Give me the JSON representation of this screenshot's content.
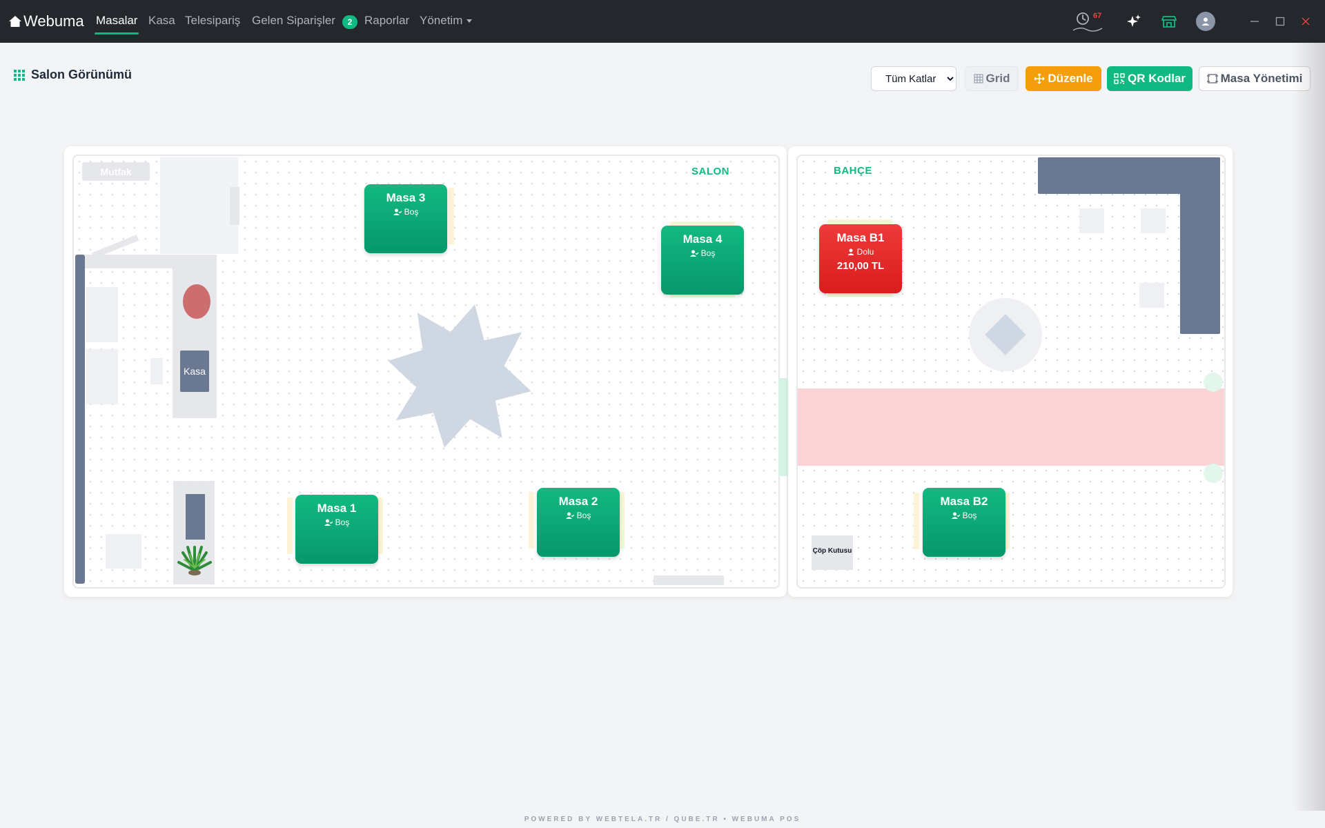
{
  "app": {
    "brand": "Webuma",
    "nav": [
      {
        "label": "Masalar",
        "active": true
      },
      {
        "label": "Kasa"
      },
      {
        "label": "Telesipariş"
      },
      {
        "label": "Gelen Siparişler"
      },
      {
        "label": "Raporlar"
      },
      {
        "label": "Yönetim"
      }
    ],
    "orders_badge": "2",
    "clock_count": "67",
    "icons": [
      "clock-icon",
      "sparkle-icon",
      "store-icon",
      "user-icon"
    ]
  },
  "header": {
    "title": "Salon Görünümü",
    "floor_select": "Tüm Katlar",
    "buttons": {
      "grid": "Grid",
      "edit": "Düzenle",
      "qr": "QR Kodlar",
      "tables": "Masa Yönetimi"
    }
  },
  "zones": {
    "salon": "SALON",
    "bahce": "BAHÇE",
    "kitchen": "Mutfak",
    "cashier": "Kasa",
    "trash": "Çöp Kutusu"
  },
  "tables": [
    {
      "name": "Masa 3",
      "status": "Boş"
    },
    {
      "name": "Masa 4",
      "status": "Boş"
    },
    {
      "name": "Masa 1",
      "status": "Boş"
    },
    {
      "name": "Masa 2",
      "status": "Boş"
    },
    {
      "name": "Masa B1",
      "status": "Dolu",
      "amount": "210,00 TL"
    },
    {
      "name": "Masa B2",
      "status": "Boş"
    }
  ],
  "colors": {
    "accent": "#10b981",
    "occupied": "#dc2626",
    "edit": "#f59e0b",
    "navbar": "#24272b"
  },
  "footer": "POWERED BY WEBTELA.TR / QUBE.TR • WEBUMA POS"
}
